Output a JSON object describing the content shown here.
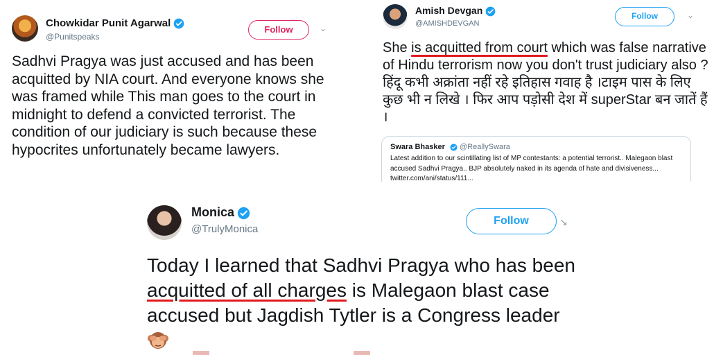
{
  "tweets": [
    {
      "name": "Chowkidar Punit Agarwal",
      "handle": "@Punitspeaks",
      "follow_label": "Follow",
      "text": "Sadhvi Pragya was just accused and has been acquitted by NIA court. And everyone knows she was framed while This man goes to the court in midnight to defend a convicted terrorist. The condition of our judiciary is such because these hypocrites unfortunately became lawyers."
    },
    {
      "name": "Amish Devgan",
      "handle": "@AMISHDEVGAN",
      "follow_label": "Follow",
      "text_before": "She ",
      "text_highlight": "is acquitted from court",
      "text_after": " which was false narrative of Hindu terrorism now you don't trust judiciary also ? हिंदू कभी अक्रांता नहीं रहे इतिहास गवाह है ।टाइम पास के लिए कुछ भी  न लिखे । फिर आप पड़ोसी देश में superStar बन जातें हैं ।",
      "quoted": {
        "name": "Swara Bhasker",
        "handle": "@ReallySwara",
        "text": "Latest addition to our scintillating list of MP contestants: a potential terrorist.. Malegaon blast accused Sadhvi Pragya.. BJP absolutely naked in its agenda of hate and divisiveness... twitter.com/ani/status/111..."
      }
    },
    {
      "name": "Monica",
      "handle": "@TrulyMonica",
      "follow_label": "Follow",
      "text_before": "Today I learned that Sadhvi Pragya who has been ",
      "text_highlight": "acquitted of all charges",
      "text_after": " is Malegaon blast case accused but Jagdish Tytler is a Congress leader "
    }
  ],
  "icons": {
    "verified": "verified-badge-icon",
    "caret": "chevron-down-icon",
    "emoji": "see-no-evil-monkey-icon"
  },
  "colors": {
    "twitter_blue": "#1da1f2",
    "follow_pink": "#e0245e",
    "highlight_underline": "#e0191e",
    "secondary_text": "#657786"
  }
}
